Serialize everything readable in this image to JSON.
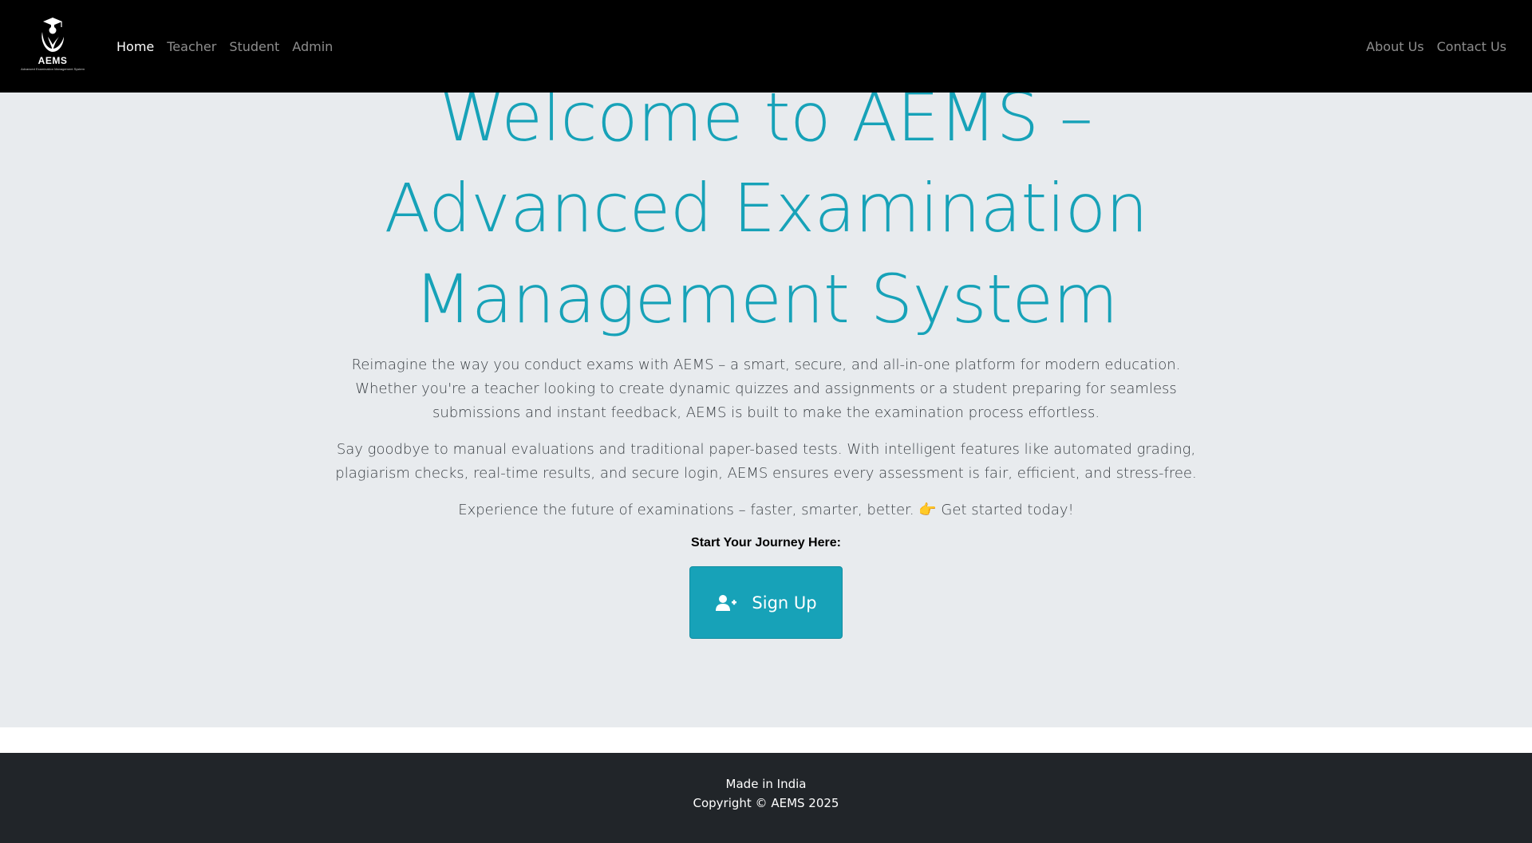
{
  "navbar": {
    "logo": {
      "name": "AEMS",
      "tagline": "Advanced Examination Management System",
      "icon": "graduate-emblem-icon"
    },
    "left_links": [
      "Home",
      "Teacher",
      "Student",
      "Admin"
    ],
    "active_link": "Home",
    "right_links": [
      "About Us",
      "Contact Us"
    ]
  },
  "hero": {
    "title": "Welcome to AEMS – Advanced Examination Management System",
    "paragraph1": "Reimagine the way you conduct exams with AEMS – a smart, secure, and all-in-one platform for modern education. Whether you're a teacher looking to create dynamic quizzes and assignments or a student preparing for seamless submissions and instant feedback, AEMS is built to make the examination process effortless.",
    "paragraph2": "Say goodbye to manual evaluations and traditional paper-based tests. With intelligent features like automated grading, plagiarism checks, real-time results, and secure login, AEMS ensures every assessment is fair, efficient, and stress-free.",
    "paragraph3": "Experience the future of examinations – faster, smarter, better. 👉 Get started today!",
    "journey_label": "Start Your Journey Here:",
    "signup_label": "Sign Up",
    "signup_icon": "user-plus-icon"
  },
  "footer": {
    "line1": "Made in India",
    "line2": "Copyright © AEMS 2025"
  },
  "colors": {
    "navbar_bg": "#000000",
    "hero_bg": "#e8ebee",
    "accent": "#17a2b8",
    "footer_bg": "#212529"
  }
}
